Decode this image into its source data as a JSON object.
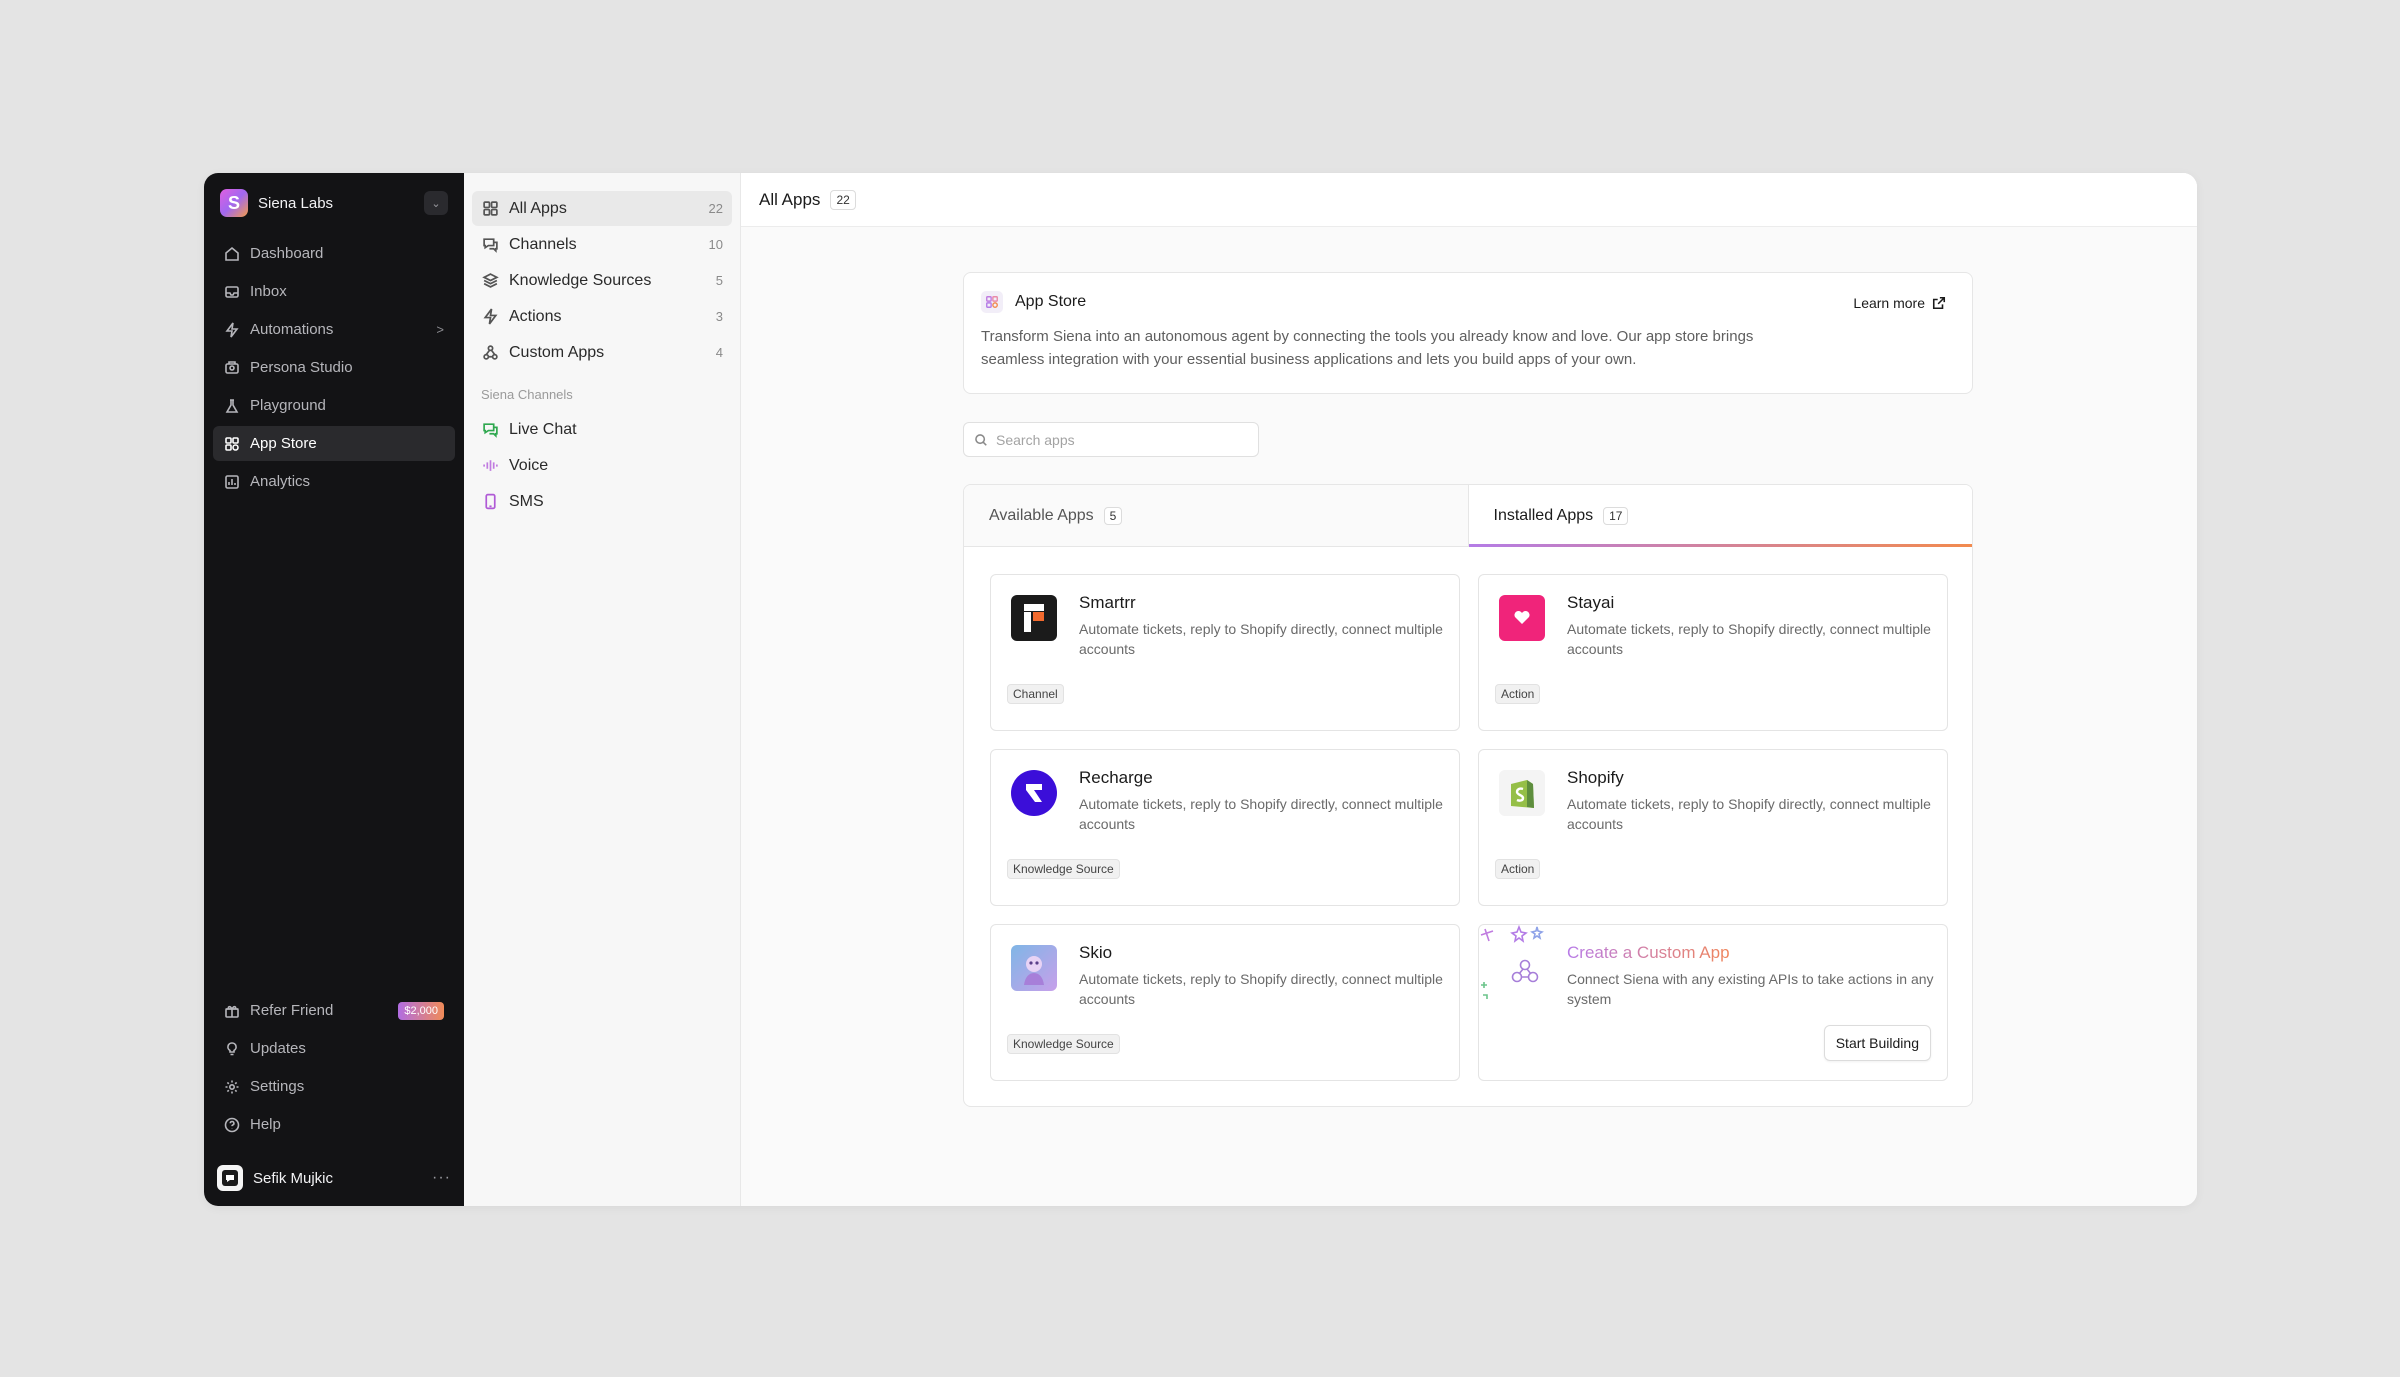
{
  "workspace": {
    "name": "Siena Labs",
    "logo_letter": "S"
  },
  "sidebar": {
    "items": [
      {
        "label": "Dashboard",
        "icon": "home-icon"
      },
      {
        "label": "Inbox",
        "icon": "inbox-icon"
      },
      {
        "label": "Automations",
        "icon": "bolt-icon",
        "chevron": ">"
      },
      {
        "label": "Persona Studio",
        "icon": "persona-icon"
      },
      {
        "label": "Playground",
        "icon": "flask-icon"
      },
      {
        "label": "App Store",
        "icon": "apps-icon",
        "active": true
      },
      {
        "label": "Analytics",
        "icon": "chart-icon"
      }
    ],
    "bottom": [
      {
        "label": "Refer Friend",
        "icon": "gift-icon",
        "badge": "$2,000"
      },
      {
        "label": "Updates",
        "icon": "bulb-icon"
      },
      {
        "label": "Settings",
        "icon": "gear-icon"
      },
      {
        "label": "Help",
        "icon": "help-icon"
      }
    ],
    "user": {
      "name": "Sefik Mujkic",
      "more": "···"
    }
  },
  "subnav": {
    "items": [
      {
        "label": "All Apps",
        "count": "22",
        "icon": "grid-icon",
        "active": true
      },
      {
        "label": "Channels",
        "count": "10",
        "icon": "chat-icon"
      },
      {
        "label": "Knowledge Sources",
        "count": "5",
        "icon": "layers-icon"
      },
      {
        "label": "Actions",
        "count": "3",
        "icon": "bolt-icon"
      },
      {
        "label": "Custom Apps",
        "count": "4",
        "icon": "webhook-icon"
      }
    ],
    "channels_heading": "Siena Channels",
    "channels": [
      {
        "label": "Live Chat",
        "icon": "livechat-icon",
        "color": "#2fa84f"
      },
      {
        "label": "Voice",
        "icon": "voice-icon",
        "color": "#c07be0"
      },
      {
        "label": "SMS",
        "icon": "sms-icon",
        "color": "#b05ad6"
      }
    ]
  },
  "header": {
    "title": "All Apps",
    "count": "22"
  },
  "info": {
    "title": "App Store",
    "learn_more": "Learn more",
    "description": "Transform Siena into an autonomous agent by connecting the tools you already know and love. Our app store brings seamless integration with your essential business applications and lets you build apps of your own."
  },
  "search": {
    "placeholder": "Search apps",
    "value": ""
  },
  "tabs": [
    {
      "label": "Available Apps",
      "count": "5"
    },
    {
      "label": "Installed Apps",
      "count": "17",
      "active": true
    }
  ],
  "apps": [
    {
      "name": "Smartrr",
      "description": "Automate tickets, reply to Shopify directly, connect multiple accounts",
      "tag": "Channel",
      "logo": "smartrr-logo"
    },
    {
      "name": "Stayai",
      "description": "Automate tickets, reply to Shopify directly, connect multiple accounts",
      "tag": "Action",
      "logo": "stayai-logo"
    },
    {
      "name": "Recharge",
      "description": "Automate tickets, reply to Shopify directly, connect multiple accounts",
      "tag": "Knowledge Source",
      "logo": "recharge-logo"
    },
    {
      "name": "Shopify",
      "description": "Automate tickets, reply to Shopify directly, connect multiple accounts",
      "tag": "Action",
      "logo": "shopify-logo"
    },
    {
      "name": "Skio",
      "description": "Automate tickets, reply to Shopify directly, connect multiple accounts",
      "tag": "Knowledge Source",
      "logo": "skio-logo"
    }
  ],
  "custom_app": {
    "title": "Create a Custom App",
    "description": "Connect Siena with any existing APIs to take actions in any system",
    "button": "Start Building"
  },
  "colors": {
    "accent_start": "#b47ce6",
    "accent_end": "#f28a4e",
    "sidebar_bg": "#131315"
  }
}
